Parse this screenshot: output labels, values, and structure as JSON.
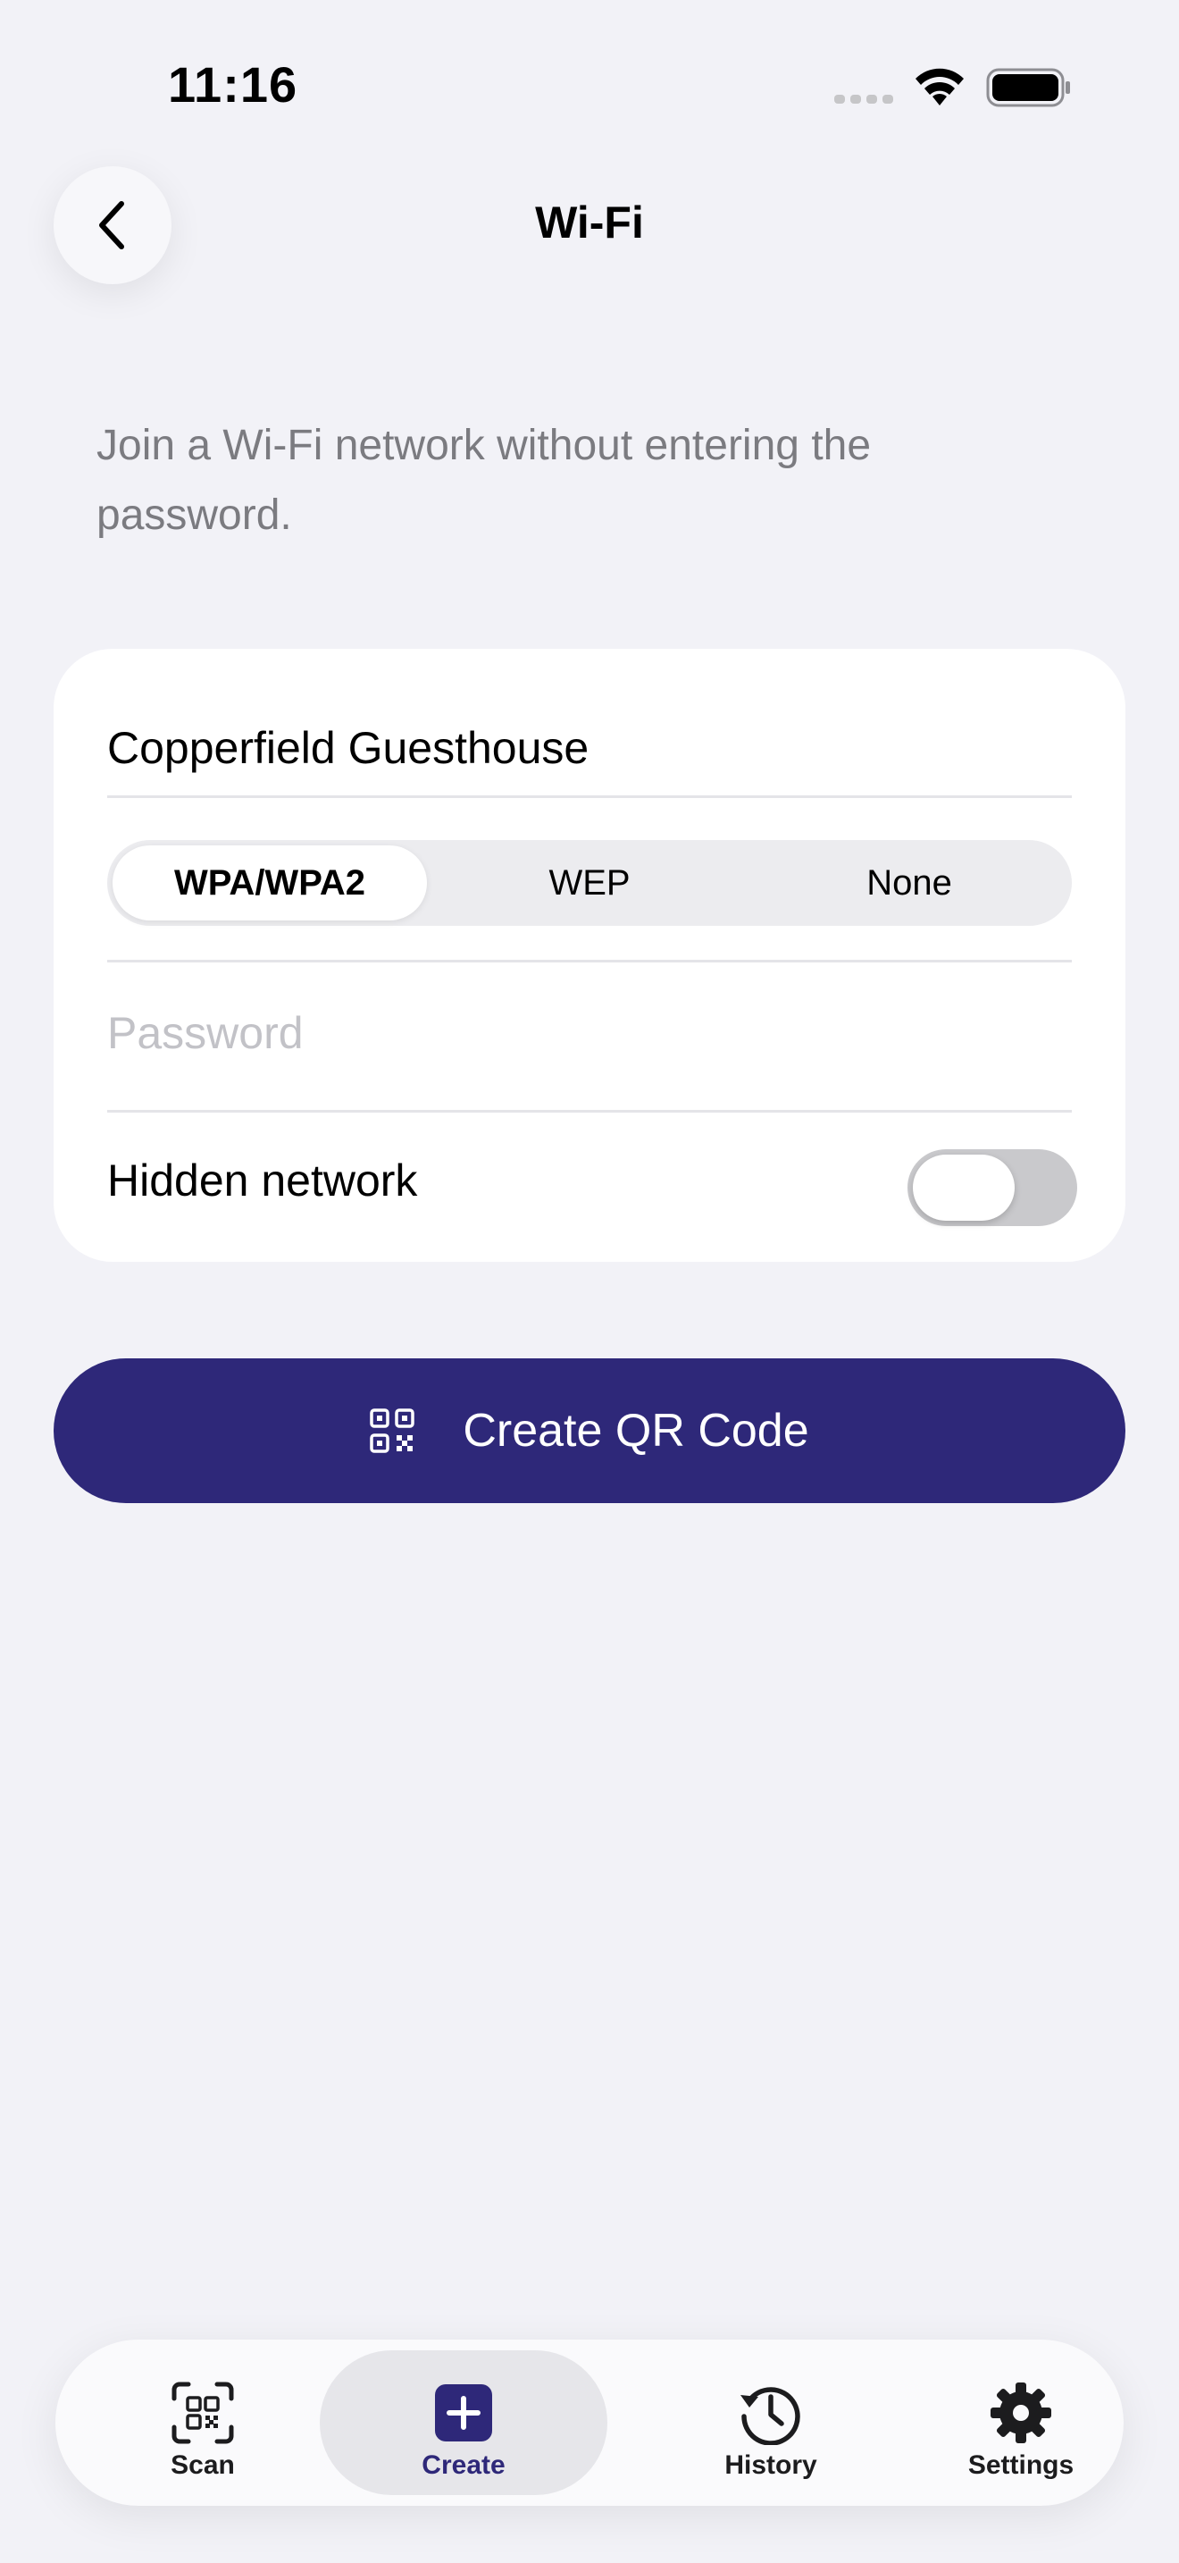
{
  "status_bar": {
    "time": "11:16"
  },
  "nav": {
    "title": "Wi-Fi"
  },
  "description": "Join a Wi-Fi network without entering the password.",
  "form": {
    "network_name": "Copperfield Guesthouse",
    "security": {
      "options": [
        "WPA/WPA2",
        "WEP",
        "None"
      ],
      "selected": "WPA/WPA2"
    },
    "password_placeholder": "Password",
    "hidden_network_label": "Hidden network",
    "hidden_network_on": false
  },
  "create_button": {
    "label": "Create QR Code",
    "icon": "qr-code-icon"
  },
  "tab_bar": {
    "items": [
      {
        "label": "Scan",
        "icon": "scan-qr-icon"
      },
      {
        "label": "Create",
        "icon": "plus-square-icon"
      },
      {
        "label": "History",
        "icon": "history-icon"
      },
      {
        "label": "Settings",
        "icon": "gear-icon"
      }
    ],
    "active": "Create"
  },
  "colors": {
    "accent": "#2e2879",
    "background": "#f2f2f7",
    "card": "#ffffff",
    "secondary_text": "#7b7b80",
    "placeholder": "#c2c2c7",
    "toggle_off": "#c9c9cc"
  }
}
